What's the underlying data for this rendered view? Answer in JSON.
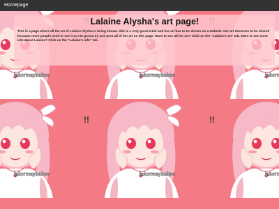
{
  "nav": {
    "homepage_label": "Homepage"
  },
  "page": {
    "title": "Lalaine Alysha's art page!",
    "description": "This is a page where all the art of Lalaine Alysha is being shown. She is a very good artist and her art has to be shown on a website. Her art deserves to be shared because more people need to see it so I'm gonna try and post all of her art on this page. Want to see all her art? Click on the \"Lalaine's art\" tab. Want to see more info about Lalaine? Click on the \"Lalaine's info\" tab.",
    "watermark": "jakormaybakee"
  },
  "colors": {
    "background": "#f47a86",
    "topbar": "#333333",
    "panel": "#ffc8cd",
    "hair": "#f7b8c7",
    "skin": "#fde6df",
    "shirt": "#ffffff",
    "eyes": "#e8385a"
  },
  "background_art": {
    "description_icon": "anime-girl-portrait-tile"
  }
}
